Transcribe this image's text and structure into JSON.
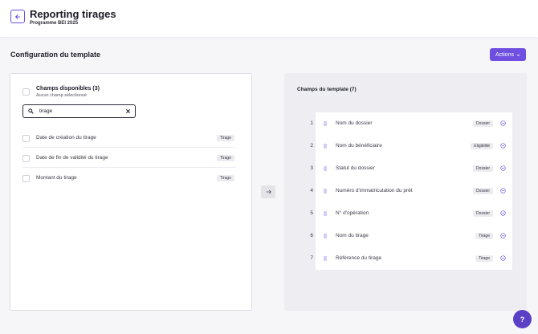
{
  "header": {
    "title": "Reporting tirages",
    "subtitle": "Programme BEI 2025",
    "back_icon": "arrow-left-icon"
  },
  "section": {
    "title": "Configuration du template",
    "actions_label": "Actions"
  },
  "available": {
    "title": "Champs disponibles (3)",
    "subtitle": "Aucun champ sélectionné",
    "search_value": "tirage",
    "items": [
      {
        "label": "Date de création du tirage",
        "tag": "Tirage"
      },
      {
        "label": "Date de fin de validité du tirage",
        "tag": "Tirage"
      },
      {
        "label": "Montant du tirage",
        "tag": "Tirage"
      }
    ]
  },
  "template": {
    "title": "Champs du template (7)",
    "items": [
      {
        "num": "1",
        "label": "Nom du dossier",
        "tag": "Dossier"
      },
      {
        "num": "2",
        "label": "Nom du bénéficiaire",
        "tag": "Eligibilité"
      },
      {
        "num": "3",
        "label": "Statut du dossier",
        "tag": "Dossier"
      },
      {
        "num": "4",
        "label": "Numéro d'immatriculation du prêt",
        "tag": "Dossier"
      },
      {
        "num": "5",
        "label": "N° d'opération",
        "tag": "Dossier"
      },
      {
        "num": "6",
        "label": "Nom du tirage",
        "tag": "Tirage"
      },
      {
        "num": "7",
        "label": "Référence du tirage",
        "tag": "Tirage"
      }
    ]
  },
  "help": {
    "label": "?"
  },
  "colors": {
    "accent": "#6e4fe0",
    "help": "#5b3fc4"
  }
}
